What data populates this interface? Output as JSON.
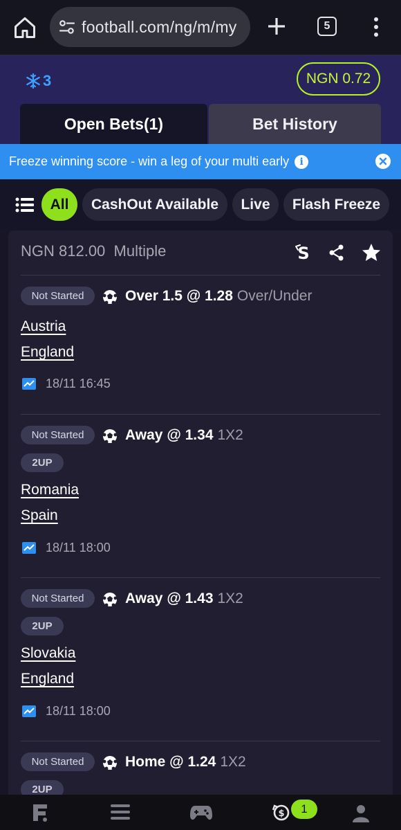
{
  "browser": {
    "url": "football.com/ng/m/my",
    "tab_count": "5"
  },
  "header": {
    "freeze_count": "3",
    "balance": "NGN 0.72",
    "tabs": [
      {
        "label": "Open Bets(1)",
        "active": true
      },
      {
        "label": "Bet History",
        "active": false
      }
    ]
  },
  "banner": {
    "text": "Freeze winning score - win a leg of your multi early",
    "info_glyph": "i"
  },
  "filters": [
    {
      "label": "All",
      "active": true
    },
    {
      "label": "CashOut Available",
      "active": false
    },
    {
      "label": "Live",
      "active": false
    },
    {
      "label": "Flash Freeze",
      "active": false
    }
  ],
  "bet": {
    "stake": "NGN 812.00",
    "type": "Multiple",
    "legs": [
      {
        "status": "Not Started",
        "pick": "Over 1.5 @ 1.28",
        "market": "Over/Under",
        "twoup": "",
        "home": "Austria",
        "away": "England",
        "kickoff": "18/11 16:45"
      },
      {
        "status": "Not Started",
        "pick": "Away @ 1.34",
        "market": "1X2",
        "twoup": "2UP",
        "home": "Romania",
        "away": "Spain",
        "kickoff": "18/11 18:00"
      },
      {
        "status": "Not Started",
        "pick": "Away @ 1.43",
        "market": "1X2",
        "twoup": "2UP",
        "home": "Slovakia",
        "away": "England",
        "kickoff": "18/11 18:00"
      },
      {
        "status": "Not Started",
        "pick": "Home @ 1.24",
        "market": "1X2",
        "twoup": "2UP",
        "home": "",
        "away": "",
        "kickoff": ""
      }
    ]
  },
  "bottom_nav": {
    "cashout_badge": "1"
  },
  "colors": {
    "accent_green": "#8ee01c",
    "banner_blue": "#2e8ff0",
    "header_purple": "#28235a"
  }
}
